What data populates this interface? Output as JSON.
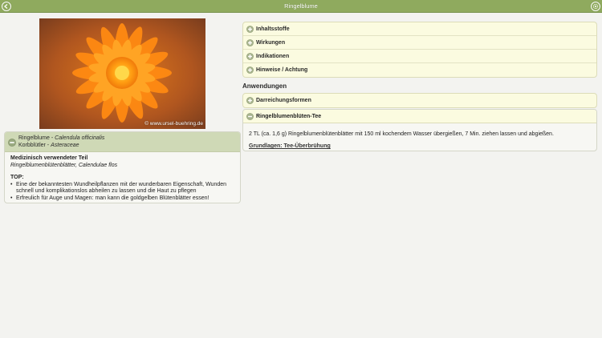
{
  "header": {
    "title": "Ringelblume",
    "accent": "#8faa5e"
  },
  "photo": {
    "copyright": "© www.ursel-buehring.de"
  },
  "plant": {
    "name": "Ringelblume",
    "separator": " - ",
    "latin": "Calendula officinalis",
    "family": "Korbblütler",
    "family_latin": "Asteraceae",
    "part_heading": "Medizinisch verwendeter Teil",
    "part_text": "Ringelblumenblütenblätter, Calendulae flos",
    "top_heading": "TOP:",
    "top_items": [
      "Eine der bekanntesten Wundheilpflanzen mit der wunderbaren Eigenschaft, Wunden schnell und komplikationslos abheilen zu lassen und die Haut zu pflegen",
      "Erfreulich für Auge und Magen: man kann die goldgelben Blütenblätter essen!"
    ]
  },
  "sections": [
    {
      "label": "Inhaltsstoffe"
    },
    {
      "label": "Wirkungen"
    },
    {
      "label": "Indikationen"
    },
    {
      "label": "Hinweise / Achtung"
    }
  ],
  "applications": {
    "title": "Anwendungen",
    "forms_label": "Darreichungsformen",
    "tea_label": "Ringelblumenblüten-Tee",
    "tea_text": "2 TL (ca. 1,6 g) Ringelblumenblütenblätter mit 150 ml kochendem Wasser übergießen, 7 Min. ziehen lassen und abgießen.",
    "tea_link": "Grundlagen: Tee-Überbrühung"
  }
}
